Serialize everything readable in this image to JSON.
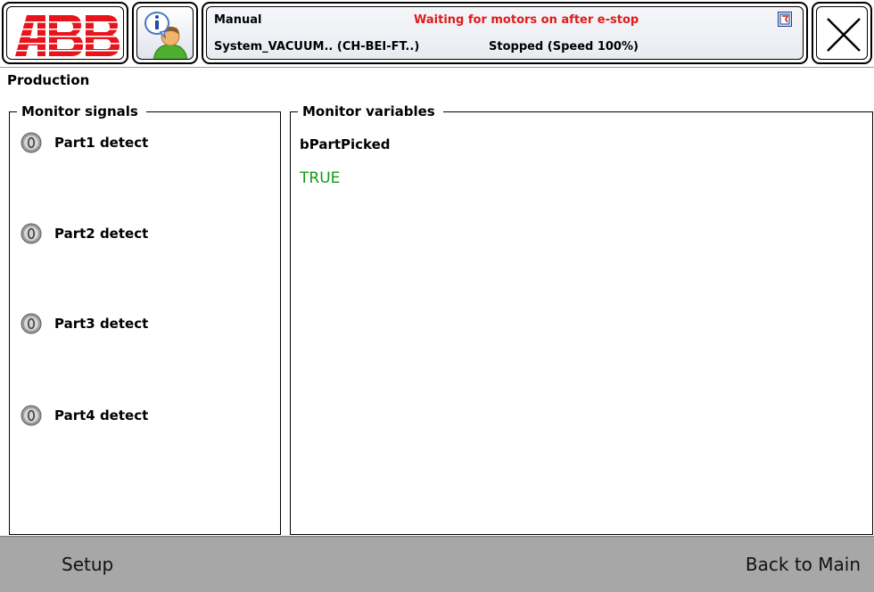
{
  "header": {
    "brand": "ABB",
    "operating_mode": "Manual",
    "status_message": "Waiting for motors on after e-stop",
    "system_name": "System_VACUUM.. (CH-BEI-FT..)",
    "controller_state": "Stopped (Speed 100%)",
    "icons": {
      "info": "info-person-icon",
      "lock": "lock-status-icon",
      "close": "close-icon"
    }
  },
  "page": {
    "title": "Production"
  },
  "monitor_signals": {
    "title": "Monitor signals",
    "items": [
      {
        "label": "Part1 detect",
        "state": 0
      },
      {
        "label": "Part2 detect",
        "state": 0
      },
      {
        "label": "Part3 detect",
        "state": 0
      },
      {
        "label": "Part4 detect",
        "state": 0
      }
    ]
  },
  "monitor_variables": {
    "title": "Monitor variables",
    "items": [
      {
        "name": "bPartPicked",
        "value": "TRUE"
      }
    ]
  },
  "footer": {
    "setup_label": "Setup",
    "back_label": "Back to Main"
  },
  "colors": {
    "warning": "#e01b1b",
    "value_true": "#159a15",
    "abb_red": "#e8141b",
    "bottom_bar": "#a7a7a7"
  }
}
